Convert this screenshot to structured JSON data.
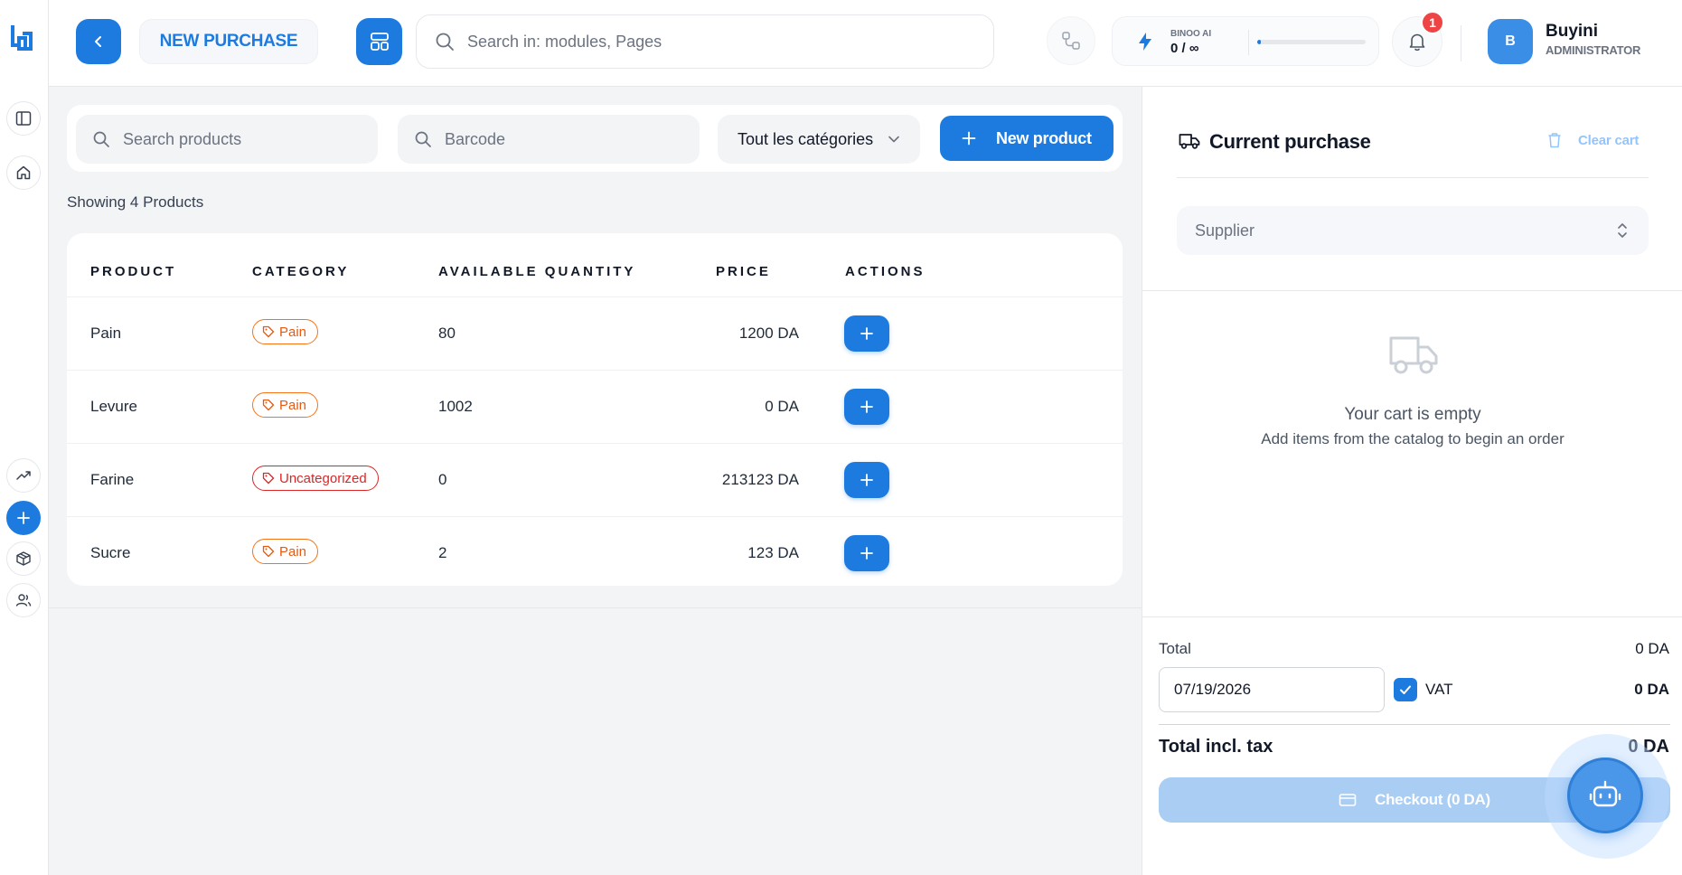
{
  "header": {
    "title": "NEW PURCHASE",
    "search_placeholder": "Search in: modules, Pages",
    "ai": {
      "label": "BINOO AI",
      "quota": "0 / ∞",
      "usage_fraction": 0.03
    },
    "notifications_count": "1",
    "user": {
      "initial": "B",
      "name": "Buyini",
      "role": "ADMINISTRATOR"
    }
  },
  "sidebar": {
    "items": [
      {
        "icon": "panel-toggle-icon"
      },
      {
        "icon": "home-icon"
      },
      {
        "icon": "trending-up-icon"
      },
      {
        "icon": "plus-icon",
        "active": true
      },
      {
        "icon": "package-icon"
      },
      {
        "icon": "users-icon"
      }
    ]
  },
  "filters": {
    "search_placeholder": "Search products",
    "barcode_placeholder": "Barcode",
    "category_selected": "Tout les catégories",
    "new_product_label": "New product"
  },
  "showing_text": "Showing 4 Products",
  "table": {
    "headers": [
      "PRODUCT",
      "CATEGORY",
      "AVAILABLE QUANTITY",
      "PRICE",
      "ACTIONS"
    ],
    "rows": [
      {
        "product": "Pain",
        "category": "Pain",
        "category_color": "#f97316",
        "quantity": "80",
        "price": "1200 DA"
      },
      {
        "product": "Levure",
        "category": "Pain",
        "category_color": "#f97316",
        "quantity": "1002",
        "price": "0 DA"
      },
      {
        "product": "Farine",
        "category": "Uncategorized",
        "category_color": "#dc2626",
        "quantity": "0",
        "price": "213123 DA"
      },
      {
        "product": "Sucre",
        "category": "Pain",
        "category_color": "#f97316",
        "quantity": "2",
        "price": "123 DA"
      }
    ]
  },
  "cart": {
    "title": "Current purchase",
    "clear_label": "Clear cart",
    "supplier_placeholder": "Supplier",
    "empty_title": "Your cart is empty",
    "empty_subtitle": "Add items from the catalog to begin an order",
    "total_label": "Total",
    "total_value": "0 DA",
    "date_value": "07/19/2026",
    "vat_label": "VAT",
    "vat_checked": true,
    "vat_value": "0 DA",
    "total_incl_label": "Total incl. tax",
    "total_incl_value": "0 DA",
    "checkout_label": "Checkout (0 DA)"
  },
  "colors": {
    "accent": "#1d7be0",
    "tag_orange": "#f97316",
    "tag_red": "#dc2626",
    "badge": "#ef4444"
  }
}
